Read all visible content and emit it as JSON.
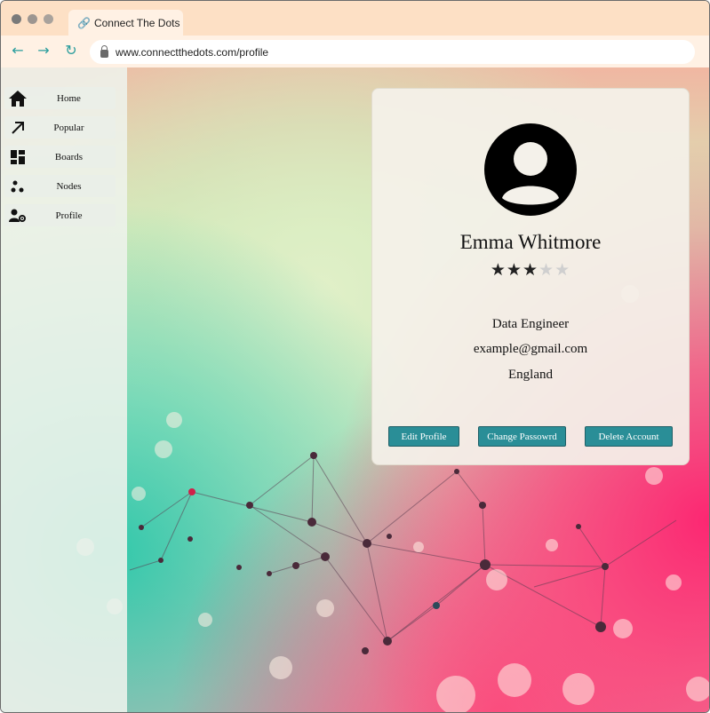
{
  "browser": {
    "tab_title": "Connect The Dots",
    "url": "www.connectthedots.com/profile"
  },
  "sidebar": {
    "items": [
      {
        "label": "Home",
        "icon": "home-icon"
      },
      {
        "label": "Popular",
        "icon": "trending-arrow-icon"
      },
      {
        "label": "Boards",
        "icon": "dashboard-icon"
      },
      {
        "label": "Nodes",
        "icon": "nodes-icon"
      },
      {
        "label": "Profile",
        "icon": "profile-settings-icon"
      }
    ]
  },
  "profile": {
    "name": "Emma Whitmore",
    "rating": 3,
    "rating_max": 5,
    "role": "Data Engineer",
    "email": "example@gmail.com",
    "location": "England"
  },
  "actions": {
    "edit": "Edit Profile",
    "change_password": "Change Passowrd",
    "delete": "Delete Account"
  },
  "colors": {
    "accent": "#2a8e97",
    "nav_icons": "#2a9d9d",
    "titlebar": "#fde0c5"
  }
}
